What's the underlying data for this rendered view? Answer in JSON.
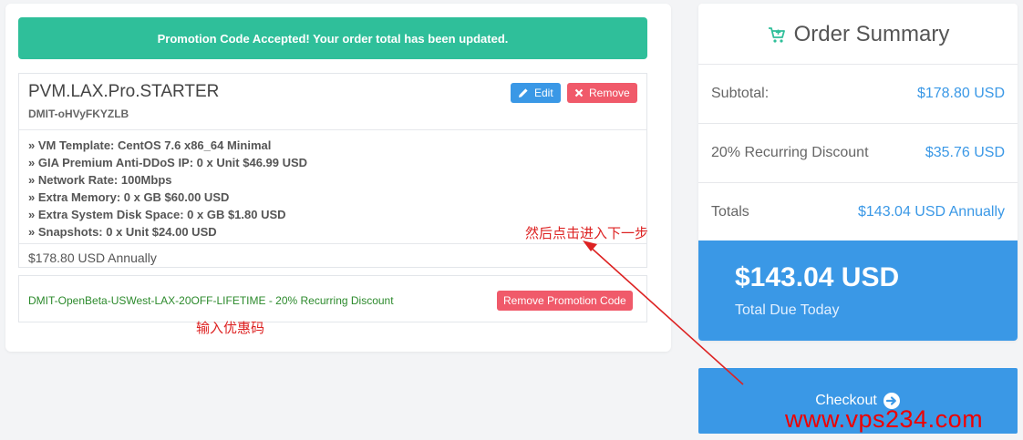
{
  "alert": {
    "message": "Promotion Code Accepted! Your order total has been updated."
  },
  "product": {
    "name": "PVM.LAX.Pro.STARTER",
    "domain": "DMIT-oHVyFKYZLB",
    "edit_label": "Edit",
    "remove_label": "Remove",
    "configs": [
      "» VM Template: CentOS 7.6 x86_64 Minimal",
      "» GIA Premium Anti-DDoS IP: 0 x Unit $46.99 USD",
      "» Network Rate: 100Mbps",
      "» Extra Memory: 0 x GB $60.00 USD",
      "» Extra System Disk Space: 0 x GB $1.80 USD",
      "» Snapshots: 0 x Unit $24.00 USD"
    ],
    "price": "$178.80 USD Annually"
  },
  "promo": {
    "code_text": "DMIT-OpenBeta-USWest-LAX-20OFF-LIFETIME - 20% Recurring Discount",
    "remove_label": "Remove Promotion Code"
  },
  "annotations": {
    "promo_note": "输入优惠码",
    "next_note": "然后点击进入下一步"
  },
  "summary": {
    "title": "Order Summary",
    "rows": [
      {
        "label": "Subtotal:",
        "value": "$178.80 USD"
      },
      {
        "label": "20% Recurring Discount",
        "value": "$35.76 USD"
      },
      {
        "label": "Totals",
        "value": "$143.04 USD Annually"
      }
    ],
    "due_amount": "$143.04 USD",
    "due_label": "Total Due Today"
  },
  "checkout": {
    "label": "Checkout"
  },
  "watermark": "www.vps234.com",
  "colors": {
    "accent": "#3a98e6",
    "success": "#2fbf9a",
    "danger": "#f05a6a",
    "annotation": "#dd2222"
  }
}
